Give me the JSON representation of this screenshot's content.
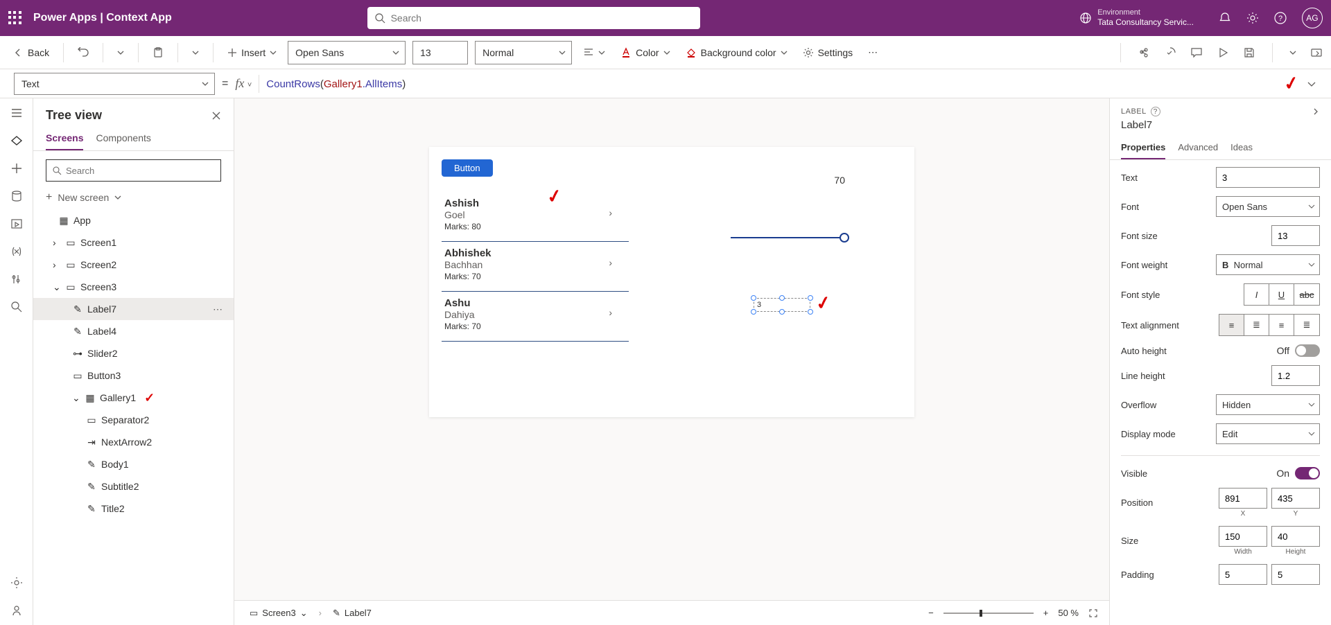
{
  "header": {
    "app_title": "Power Apps  |  Context App",
    "search_placeholder": "Search",
    "env_label": "Environment",
    "env_name": "Tata Consultancy Servic...",
    "avatar": "AG"
  },
  "toolbar": {
    "back": "Back",
    "insert": "Insert",
    "font": "Open Sans",
    "font_size": "13",
    "font_weight": "Normal",
    "color": "Color",
    "bg_color": "Background color",
    "settings": "Settings"
  },
  "formula": {
    "property": "Text",
    "fn": "CountRows",
    "id": "Gallery1",
    "prop": ".AllItems"
  },
  "tree": {
    "title": "Tree view",
    "tabs": {
      "screens": "Screens",
      "components": "Components"
    },
    "search_placeholder": "Search",
    "new_screen": "New screen",
    "items": {
      "app": "App",
      "screen1": "Screen1",
      "screen2": "Screen2",
      "screen3": "Screen3",
      "label7": "Label7",
      "label4": "Label4",
      "slider2": "Slider2",
      "button3": "Button3",
      "gallery1": "Gallery1",
      "separator2": "Separator2",
      "nextarrow2": "NextArrow2",
      "body1": "Body1",
      "subtitle2": "Subtitle2",
      "title2": "Title2"
    }
  },
  "canvas": {
    "button": "Button",
    "slider_value": "70",
    "label_value": "3",
    "gallery": [
      {
        "title": "Ashish",
        "sub": "Goel",
        "body": "Marks: 80"
      },
      {
        "title": "Abhishek",
        "sub": "Bachhan",
        "body": "Marks: 70"
      },
      {
        "title": "Ashu",
        "sub": "Dahiya",
        "body": "Marks: 70"
      }
    ]
  },
  "breadcrumb": {
    "screen": "Screen3",
    "control": "Label7",
    "zoom": "50  %"
  },
  "props": {
    "type": "LABEL",
    "name": "Label7",
    "tabs": {
      "properties": "Properties",
      "advanced": "Advanced",
      "ideas": "Ideas"
    },
    "text_lbl": "Text",
    "text_val": "3",
    "font_lbl": "Font",
    "font_val": "Open Sans",
    "fontsize_lbl": "Font size",
    "fontsize_val": "13",
    "fw_lbl": "Font weight",
    "fw_val": "Normal",
    "fs_lbl": "Font style",
    "ta_lbl": "Text alignment",
    "ah_lbl": "Auto height",
    "ah_val": "Off",
    "lh_lbl": "Line height",
    "lh_val": "1.2",
    "of_lbl": "Overflow",
    "of_val": "Hidden",
    "dm_lbl": "Display mode",
    "dm_val": "Edit",
    "vis_lbl": "Visible",
    "vis_val": "On",
    "pos_lbl": "Position",
    "pos_x": "891",
    "pos_y": "435",
    "x_lbl": "X",
    "y_lbl": "Y",
    "size_lbl": "Size",
    "w": "150",
    "h": "40",
    "w_lbl": "Width",
    "h_lbl": "Height",
    "pad_lbl": "Padding",
    "pad_t": "5",
    "pad_b": "5"
  }
}
